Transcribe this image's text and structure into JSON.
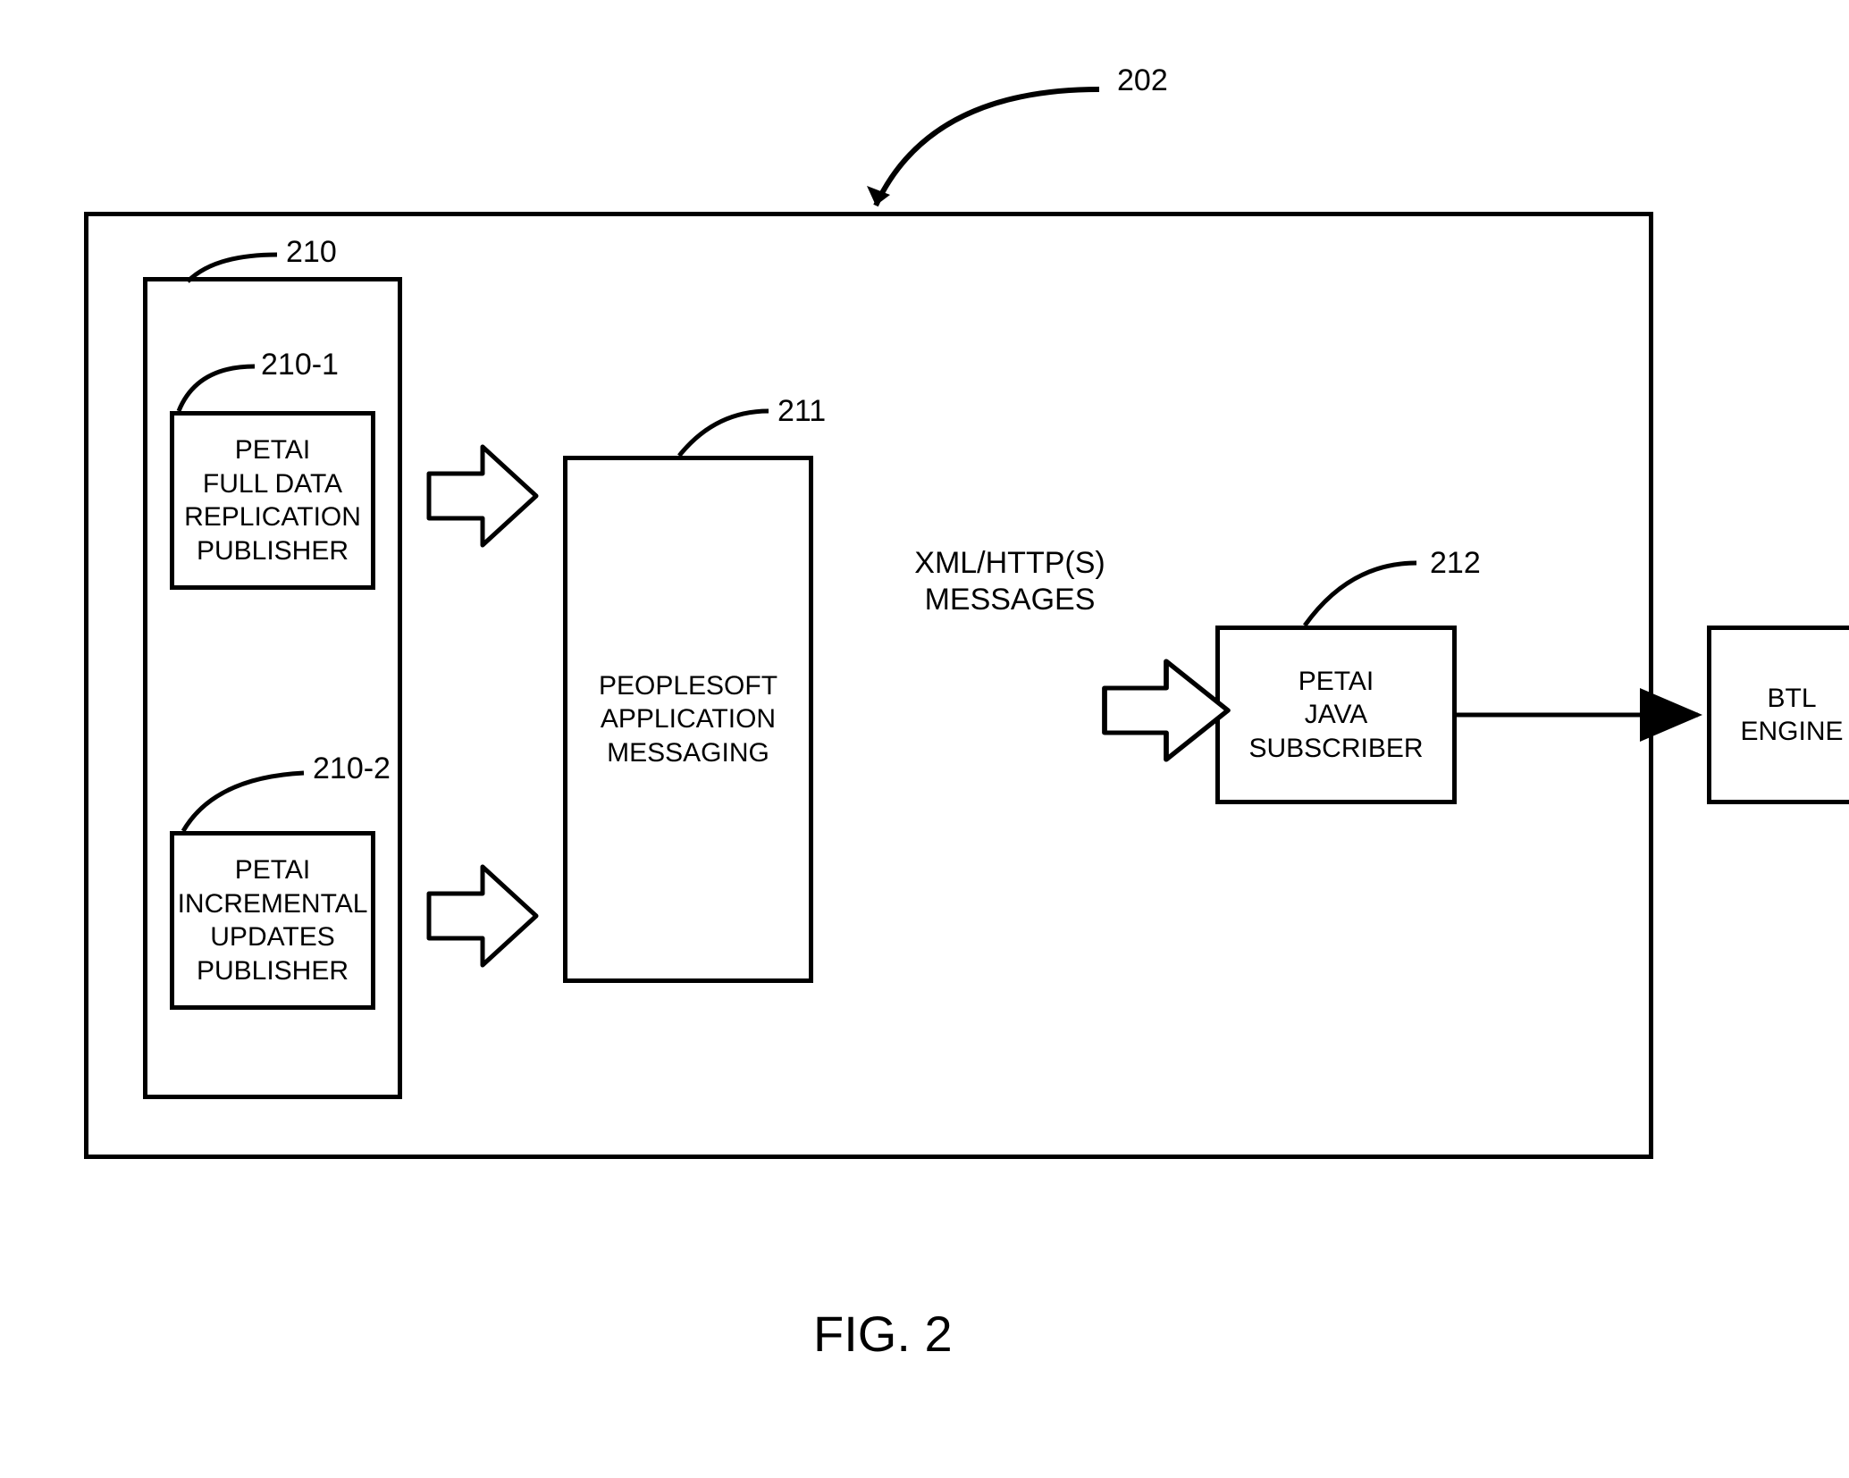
{
  "labels": {
    "main": "202",
    "publishers": "210",
    "fulldata": "210-1",
    "incremental": "210-2",
    "messaging": "211",
    "subscriber": "212"
  },
  "boxes": {
    "fulldata": "PETAI\nFULL DATA\nREPLICATION\nPUBLISHER",
    "incremental": "PETAI\nINCREMENTAL\nUPDATES\nPUBLISHER",
    "messaging": "PEOPLESOFT\nAPPLICATION\nMESSAGING",
    "subscriber": "PETAI\nJAVA\nSUBSCRIBER",
    "btl": "BTL\nENGINE"
  },
  "flowtext": {
    "xml": "XML/HTTP(S)\nMESSAGES"
  },
  "caption": "FIG. 2"
}
